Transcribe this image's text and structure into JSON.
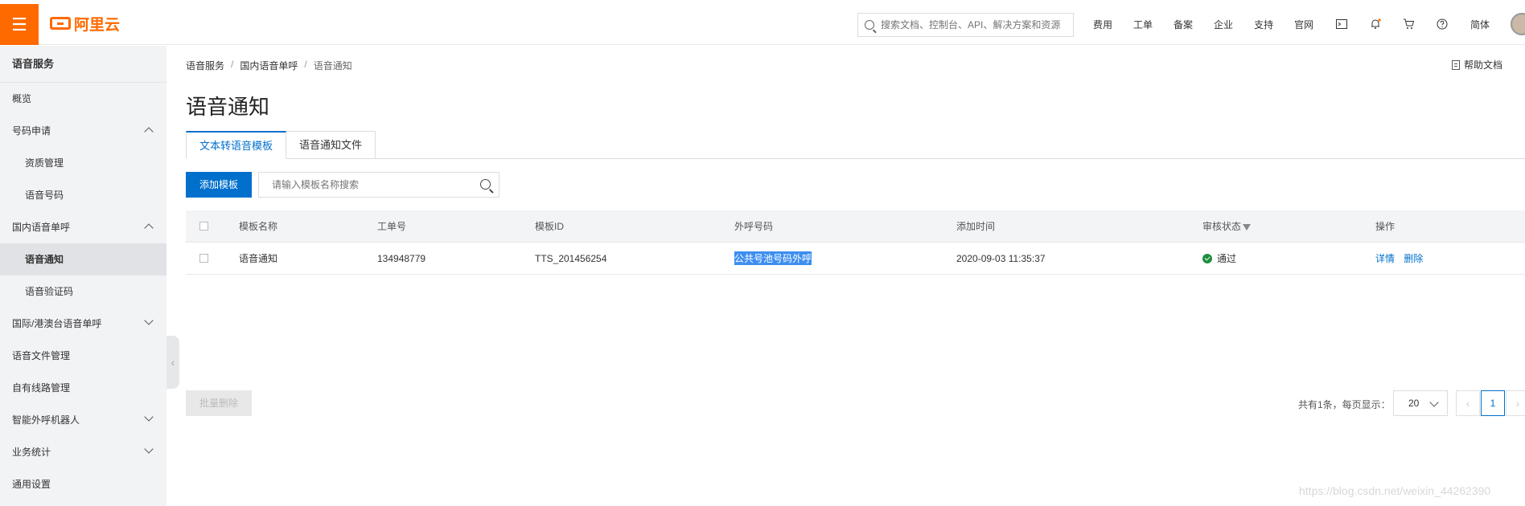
{
  "topbar": {
    "logo_text": "阿里云",
    "search_placeholder": "搜索文档、控制台、API、解决方案和资源",
    "links": [
      "费用",
      "工单",
      "备案",
      "企业",
      "支持",
      "官网"
    ],
    "language": "简体"
  },
  "sidebar": {
    "title": "语音服务",
    "items": [
      {
        "label": "概览"
      },
      {
        "label": "号码申请"
      },
      {
        "label": "资质管理"
      },
      {
        "label": "语音号码"
      },
      {
        "label": "国内语音单呼"
      },
      {
        "label": "语音通知"
      },
      {
        "label": "语音验证码"
      },
      {
        "label": "国际/港澳台语音单呼"
      },
      {
        "label": "语音文件管理"
      },
      {
        "label": "自有线路管理"
      },
      {
        "label": "智能外呼机器人"
      },
      {
        "label": "业务统计"
      },
      {
        "label": "通用设置"
      }
    ]
  },
  "breadcrumb": [
    "语音服务",
    "国内语音单呼",
    "语音通知"
  ],
  "help_label": "帮助文档",
  "page_title": "语音通知",
  "tabs": [
    "文本转语音模板",
    "语音通知文件"
  ],
  "add_button": "添加模板",
  "template_search_placeholder": "请输入模板名称搜索",
  "table": {
    "columns": [
      "模板名称",
      "工单号",
      "模板ID",
      "外呼号码",
      "添加时间",
      "审核状态",
      "操作"
    ],
    "rows": [
      {
        "name": "语音通知",
        "ticket": "134948779",
        "template_id": "TTS_201456254",
        "caller": "公共号池号码外呼",
        "added_time": "2020-09-03 11:35:37",
        "status": "通过",
        "actions": [
          "详情",
          "删除"
        ]
      }
    ]
  },
  "batch_delete_label": "批量删除",
  "pagination": {
    "summary": "共有1条，每页显示：",
    "page_size": "20",
    "current_page": "1"
  },
  "watermark": "https://blog.csdn.net/weixin_44262390"
}
